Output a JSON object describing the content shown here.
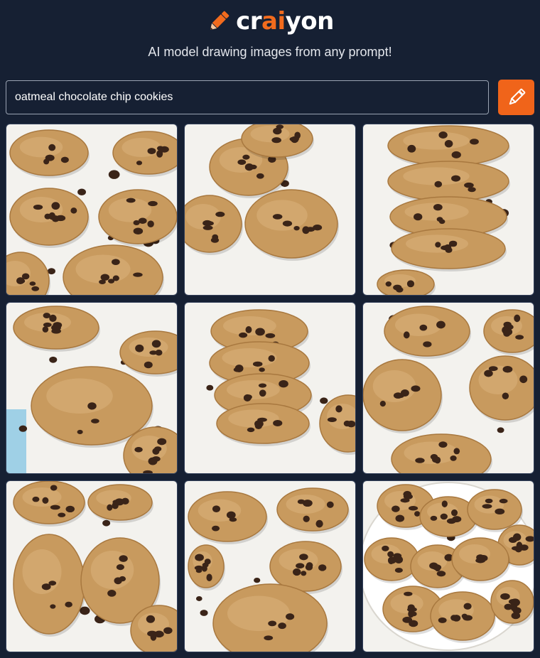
{
  "logo": {
    "icon": "pencil-icon",
    "text_before": "cr",
    "text_accent": "ai",
    "text_after": "yon",
    "accent_color": "#f26b1d"
  },
  "tagline": "AI model drawing images from any prompt!",
  "search": {
    "value": "oatmeal chocolate chip cookies",
    "button_icon": "pencil-icon",
    "button_color": "#f0641a"
  },
  "results": [
    {
      "id": 1,
      "subject": "oatmeal chocolate chip cookies scattered on white plate"
    },
    {
      "id": 2,
      "subject": "cookies with chocolate chips on white surface"
    },
    {
      "id": 3,
      "subject": "stack of four oatmeal chocolate chip cookies"
    },
    {
      "id": 4,
      "subject": "cookies on plate with blue cloth"
    },
    {
      "id": 5,
      "subject": "stack of cookies with loose chocolate chips"
    },
    {
      "id": 6,
      "subject": "cookies on white background"
    },
    {
      "id": 7,
      "subject": "flat lay of chocolate chip cookies"
    },
    {
      "id": 8,
      "subject": "cookies with large chocolate chunks"
    },
    {
      "id": 9,
      "subject": "cookies arranged on a round white plate"
    }
  ],
  "colors": {
    "background": "#162033",
    "cookie": "#c89a5e",
    "chip": "#3a2418",
    "plate": "#f3f2ee"
  }
}
